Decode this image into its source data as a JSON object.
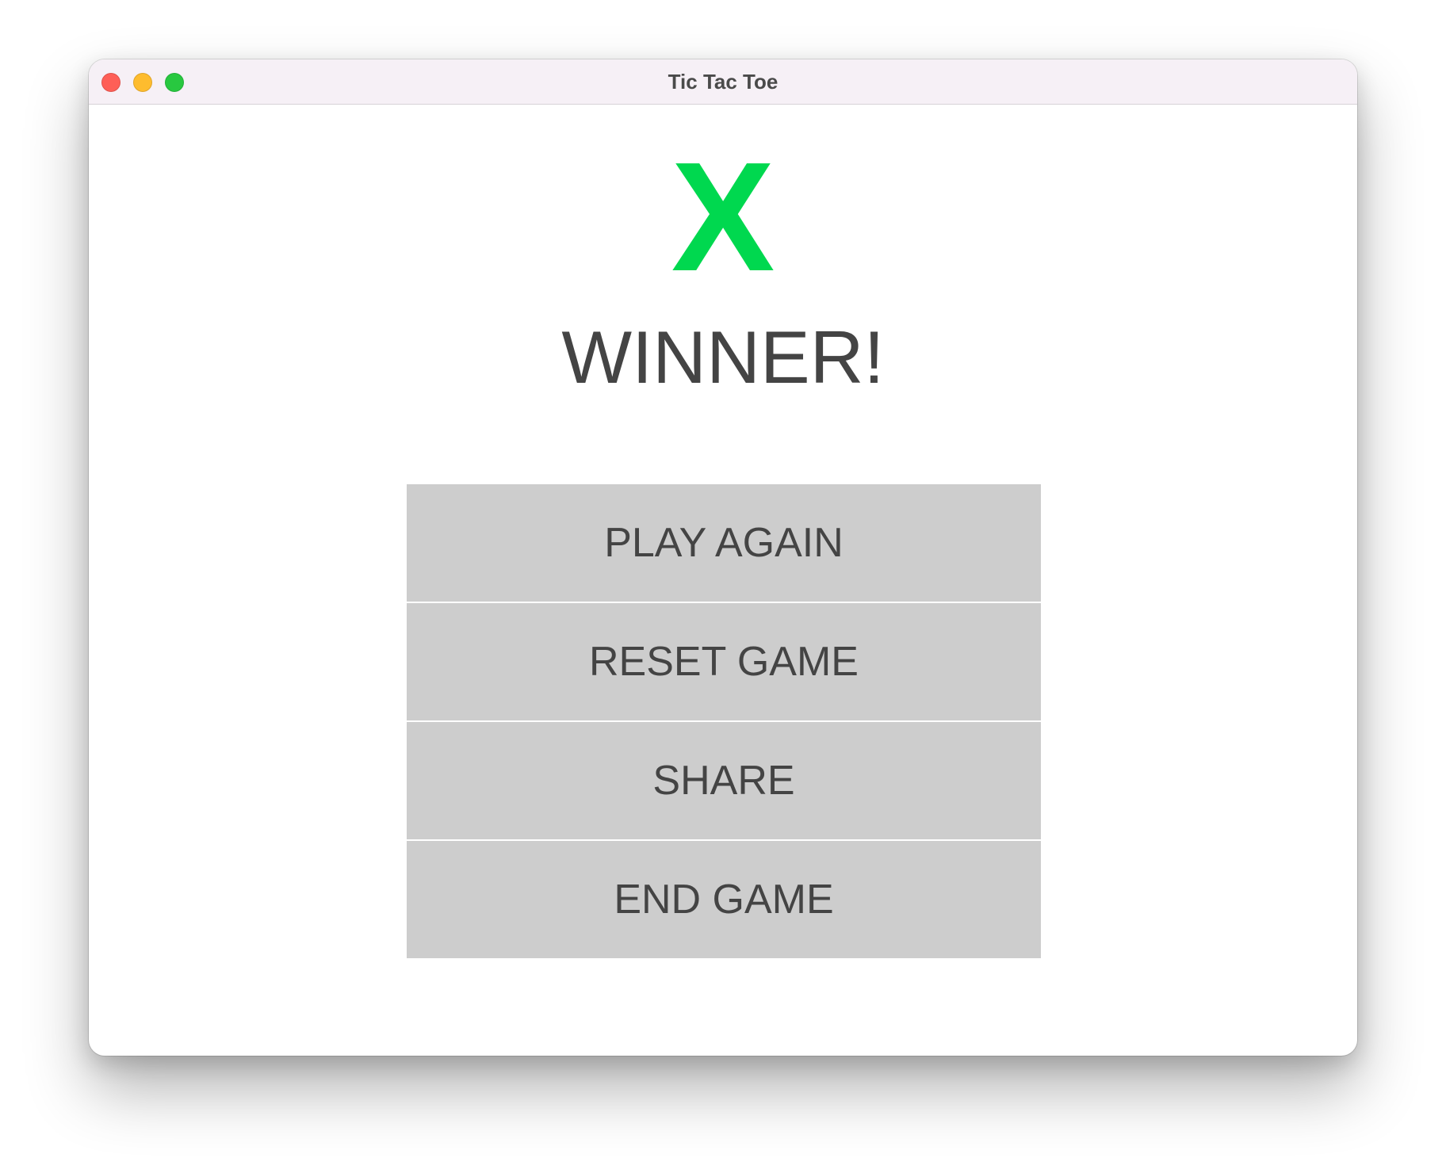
{
  "window": {
    "title": "Tic Tac Toe",
    "controls": {
      "close_color": "#fe5f57",
      "minimize_color": "#febc2e",
      "zoom_color": "#28c840"
    }
  },
  "result": {
    "player_mark": "X",
    "player_mark_color": "#00d84f",
    "message": "WINNER!"
  },
  "menu": {
    "buttons": [
      {
        "label": "PLAY AGAIN"
      },
      {
        "label": "RESET GAME"
      },
      {
        "label": "SHARE"
      },
      {
        "label": "END GAME"
      }
    ]
  }
}
